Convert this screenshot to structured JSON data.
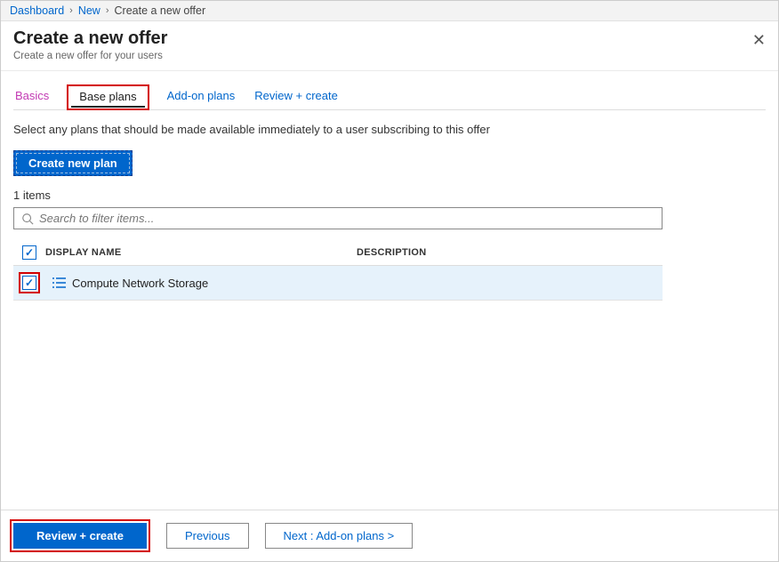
{
  "breadcrumb": {
    "items": [
      "Dashboard",
      "New"
    ],
    "current": "Create a new offer"
  },
  "header": {
    "title": "Create a new offer",
    "subtitle": "Create a new offer for your users",
    "close": "✕"
  },
  "tabs": {
    "basics": "Basics",
    "base_plans": "Base plans",
    "addon": "Add-on plans",
    "review": "Review + create"
  },
  "description": "Select any plans that should be made available immediately to a user subscribing to this offer",
  "buttons": {
    "create_plan": "Create new plan",
    "review_create": "Review + create",
    "previous": "Previous",
    "next": "Next : Add-on plans >"
  },
  "list": {
    "count_label": "1 items",
    "search_placeholder": "Search to filter items...",
    "columns": {
      "name": "DISPLAY NAME",
      "desc": "DESCRIPTION"
    },
    "rows": [
      {
        "name": "Compute Network Storage",
        "checked": true
      }
    ]
  }
}
